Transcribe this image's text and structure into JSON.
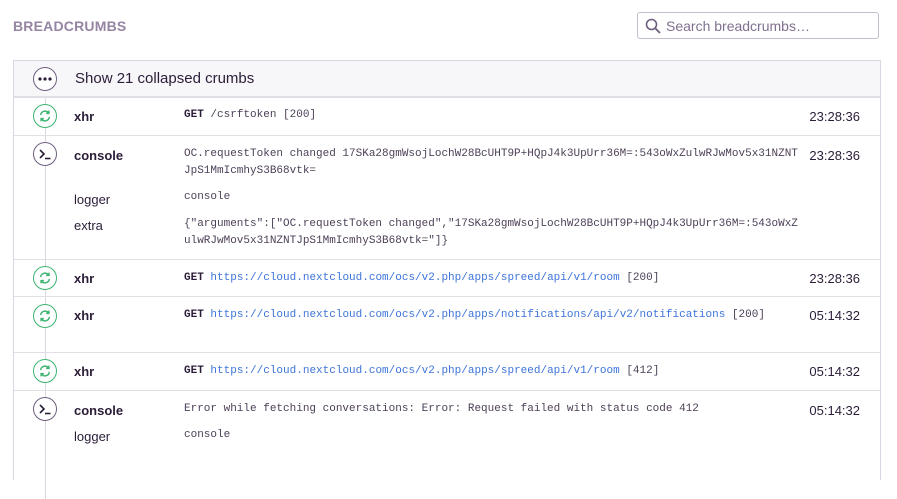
{
  "header": {
    "title": "BREADCRUMBS",
    "search_placeholder": "Search breadcrumbs…"
  },
  "collapsed": {
    "label": "Show 21 collapsed crumbs"
  },
  "crumbs": [
    {
      "category": "xhr",
      "method": "GET",
      "url": "",
      "path": "/csrftoken",
      "status": "[200]",
      "time": "23:28:36"
    },
    {
      "category": "console",
      "message": "OC.requestToken changed 17SKa28gmWsojLochW28BcUHT9P+HQpJ4k3UpUrr36M=:543oWxZulwRJwMov5x31NZNTJpS1MmIcmhyS3B68vtk=",
      "time": "23:28:36",
      "logger_label": "logger",
      "logger_value": "console",
      "extra_label": "extra",
      "extra_value": "{\"arguments\":[\"OC.requestToken changed\",\"17SKa28gmWsojLochW28BcUHT9P+HQpJ4k3UpUrr36M=:543oWxZulwRJwMov5x31NZNTJpS1MmIcmhyS3B68vtk=\"]}"
    },
    {
      "category": "xhr",
      "method": "GET",
      "url": "https://cloud.nextcloud.com/ocs/v2.php/apps/spreed/api/v1/room",
      "status": "[200]",
      "time": "23:28:36"
    },
    {
      "category": "xhr",
      "method": "GET",
      "url": "https://cloud.nextcloud.com/ocs/v2.php/apps/notifications/api/v2/notifications",
      "status": "[200]",
      "time": "05:14:32"
    },
    {
      "category": "xhr",
      "method": "GET",
      "url": "https://cloud.nextcloud.com/ocs/v2.php/apps/spreed/api/v1/room",
      "status": "[412]",
      "time": "05:14:32"
    },
    {
      "category": "console",
      "message": "Error while fetching conversations:  Error: Request failed with status code 412",
      "time": "05:14:32",
      "logger_label": "logger",
      "logger_value": "console"
    }
  ],
  "colors": {
    "xhr_icon": "#3cb371",
    "console_icon": "#6e5f7e",
    "link": "#3d74db"
  }
}
